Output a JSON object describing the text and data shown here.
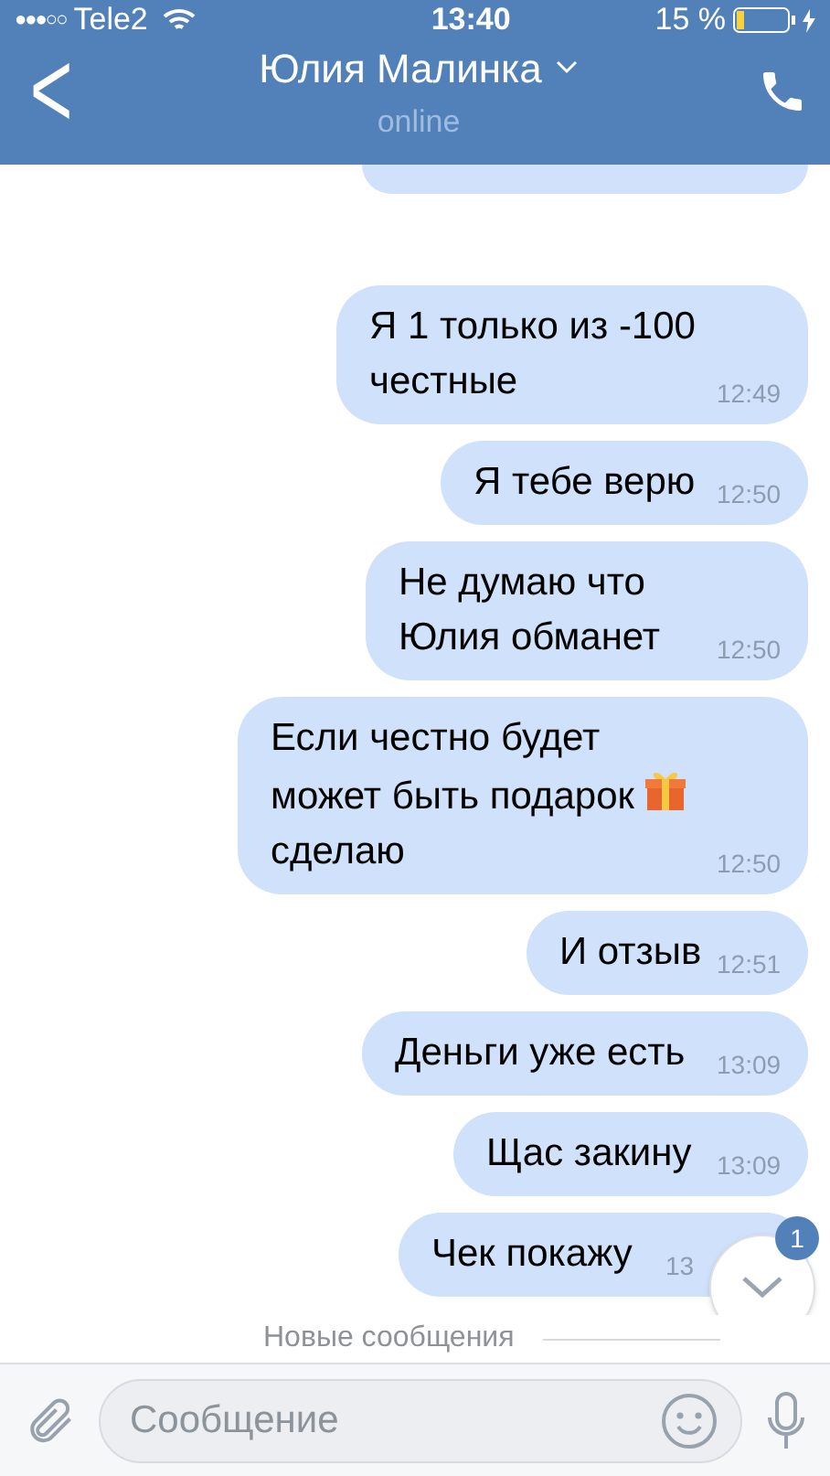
{
  "status_bar": {
    "carrier": "Tele2",
    "signal_dots": "●●●○○",
    "time": "13:40",
    "battery": "15 %"
  },
  "header": {
    "back": "<",
    "title": "Юлия Малинка",
    "subtitle": "online"
  },
  "messages": [
    {
      "text": "Я 1 только из -100 честные",
      "time": "12:49",
      "gift": false
    },
    {
      "text": "Я тебе верю",
      "time": "12:50",
      "gift": false
    },
    {
      "text": "Не думаю что Юлия обманет",
      "time": "12:50",
      "gift": false
    },
    {
      "text": "Если честно будет может быть подарок",
      "tail": "сделаю",
      "time": "12:50",
      "gift": true
    },
    {
      "text": "И отзыв",
      "time": "12:51",
      "gift": false
    },
    {
      "text": "Деньги уже есть",
      "time": "13:09",
      "gift": false
    },
    {
      "text": "Щас закину",
      "time": "13:09",
      "gift": false
    },
    {
      "text": "Чек покажу",
      "time": "13",
      "gift": false
    }
  ],
  "scroll_button": {
    "badge": "1"
  },
  "divider": "Новые сообщения",
  "composer": {
    "placeholder": "Сообщение"
  }
}
